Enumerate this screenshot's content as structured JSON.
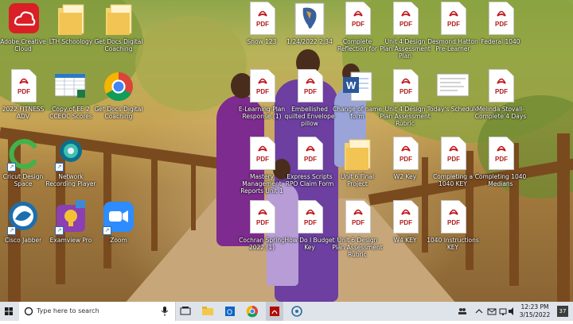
{
  "desktop": {
    "icons": [
      {
        "label": "Adobe Creative Cloud",
        "type": "creative-cloud"
      },
      {
        "label": "LTH Schoology",
        "type": "folder"
      },
      {
        "label": "Get Docs Digital Coaching",
        "type": "folder"
      },
      {
        "label": "Snow 123",
        "type": "pdf"
      },
      {
        "label": "1/24/2022 2:34",
        "type": "map"
      },
      {
        "label": "Complete Reflection for",
        "type": "pdf"
      },
      {
        "label": "Unit 4 Design Plan Assessment Plan",
        "type": "pdf"
      },
      {
        "label": "Desmond Hatton Pre-Learner",
        "type": "pdf"
      },
      {
        "label": "Federal 1040",
        "type": "pdf"
      },
      {
        "label": "2022 FITNESS ADV",
        "type": "pdf"
      },
      {
        "label": "Copy of EE 2 CCEOC Scores",
        "type": "spreadsheet"
      },
      {
        "label": "Get Docs Digital Coaching",
        "type": "chrome"
      },
      {
        "label": "E-Learning Plan Response (1)",
        "type": "pdf"
      },
      {
        "label": "Embellished quilted Envelope pillow",
        "type": "pdf"
      },
      {
        "label": "Change of name form",
        "type": "word"
      },
      {
        "label": "Unit 4 Design Plan Assessment Rubric",
        "type": "pdf"
      },
      {
        "label": "Today's Schedule",
        "type": "doc-thumb"
      },
      {
        "label": "Melinda Stovall-Complete 4 Days",
        "type": "pdf"
      },
      {
        "label": "Cricut Design Space",
        "type": "cricut"
      },
      {
        "label": "Network Recording Player",
        "type": "webex"
      },
      {
        "label": "Mastery Management Reports Unit 1",
        "type": "pdf"
      },
      {
        "label": "Express Scripts RPO Claim Form",
        "type": "pdf"
      },
      {
        "label": "Unit 6 Final Project",
        "type": "folder"
      },
      {
        "label": "W2 Key",
        "type": "pdf"
      },
      {
        "label": "Completing a 1040 KEY",
        "type": "pdf"
      },
      {
        "label": "Completing 1040 Medians",
        "type": "pdf"
      },
      {
        "label": "Cisco Jabber",
        "type": "jabber"
      },
      {
        "label": "Examview Pro",
        "type": "examview"
      },
      {
        "label": "Zoom",
        "type": "zoom"
      },
      {
        "label": "Cochran Spring 2022 (1)",
        "type": "pdf"
      },
      {
        "label": "How Do I Budget Key",
        "type": "pdf"
      },
      {
        "label": "Unit 6 Design Plan Assessment Rubric",
        "type": "pdf"
      },
      {
        "label": "W4 KEY",
        "type": "pdf"
      },
      {
        "label": "1040 Instructions KEY",
        "type": "pdf"
      }
    ]
  },
  "taskbar": {
    "search_placeholder": "Type here to search",
    "time": "12:23 PM",
    "date": "3/15/2022",
    "notification_count": "37"
  }
}
